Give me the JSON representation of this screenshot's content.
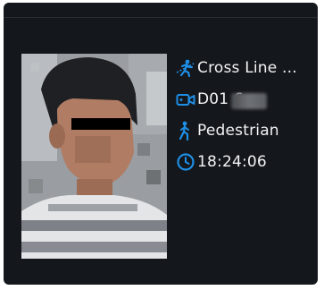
{
  "event": {
    "type_label": "Cross Line ...",
    "device_label": "D01     6...",
    "target_label": "Pedestrian",
    "time_label": "18:24:06"
  },
  "icons": {
    "event_type": "cross-line-icon",
    "device": "camera-icon",
    "target": "pedestrian-icon",
    "time": "clock-icon"
  },
  "colors": {
    "background": "#14171b",
    "accent": "#1e8fe6",
    "text": "#f2f3f4"
  }
}
